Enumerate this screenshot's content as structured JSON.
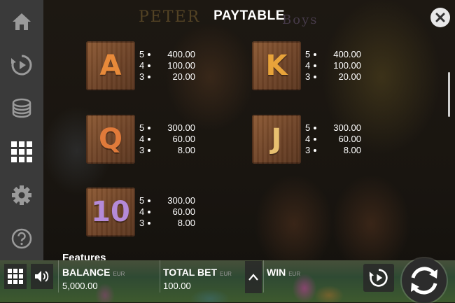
{
  "header": {
    "title": "PAYTABLE"
  },
  "background": {
    "logo_word_left": "PETER",
    "logo_word_right": "Boys"
  },
  "sidebar": {
    "items": [
      {
        "icon": "home-icon"
      },
      {
        "icon": "autoplay-icon"
      },
      {
        "icon": "coin-stack-icon"
      },
      {
        "icon": "paytable-grid-icon",
        "active": true
      },
      {
        "icon": "gear-icon"
      },
      {
        "icon": "help-icon"
      }
    ]
  },
  "colors": {
    "sidebar": "#3a3a3a",
    "tile_wood": "#6e4327",
    "letter_orange": "#e88a3a",
    "letter_purple": "#b48ad8"
  },
  "symbols": [
    {
      "letter": "A",
      "color": "#e88a3a",
      "pays": [
        {
          "count": "5",
          "value": "400.00"
        },
        {
          "count": "4",
          "value": "100.00"
        },
        {
          "count": "3",
          "value": "20.00"
        }
      ]
    },
    {
      "letter": "K",
      "color": "#e8a33a",
      "pays": [
        {
          "count": "5",
          "value": "400.00"
        },
        {
          "count": "4",
          "value": "100.00"
        },
        {
          "count": "3",
          "value": "20.00"
        }
      ]
    },
    {
      "letter": "Q",
      "color": "#e07a3a",
      "pays": [
        {
          "count": "5",
          "value": "300.00"
        },
        {
          "count": "4",
          "value": "60.00"
        },
        {
          "count": "3",
          "value": "8.00"
        }
      ]
    },
    {
      "letter": "J",
      "color": "#e8c070",
      "pays": [
        {
          "count": "5",
          "value": "300.00"
        },
        {
          "count": "4",
          "value": "60.00"
        },
        {
          "count": "3",
          "value": "8.00"
        }
      ]
    },
    {
      "letter": "10",
      "color": "#b48ad8",
      "pays": [
        {
          "count": "5",
          "value": "300.00"
        },
        {
          "count": "4",
          "value": "60.00"
        },
        {
          "count": "3",
          "value": "8.00"
        }
      ]
    }
  ],
  "sections": {
    "features": "Features"
  },
  "bottom_bar": {
    "balance_label": "BALANCE",
    "balance_currency": "EUR",
    "balance_value": "5,000.00",
    "total_bet_label": "TOTAL BET",
    "total_bet_currency": "EUR",
    "total_bet_value": "100.00",
    "win_label": "WIN",
    "win_currency": "EUR"
  }
}
